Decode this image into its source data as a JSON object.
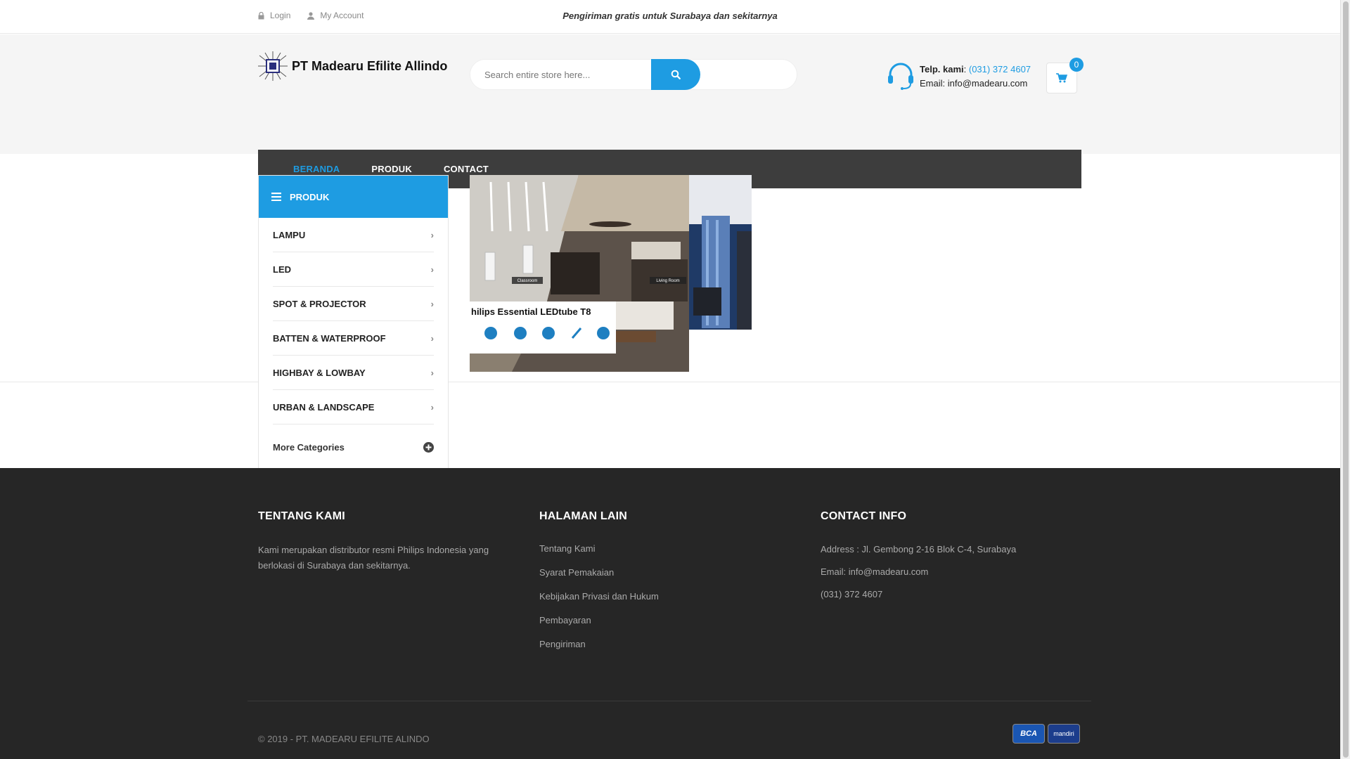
{
  "topbar": {
    "login": "Login",
    "account": "My Account",
    "promo": "Pengiriman gratis untuk Surabaya dan sekitarnya"
  },
  "header": {
    "logo_text": "PT Madearu Efilite Allindo",
    "search_placeholder": "Search entire store here...",
    "phone_label": "Telp. kami",
    "phone": "(031) 372 4607",
    "email_line": "Email: info@madearu.com",
    "cart_count": "0"
  },
  "nav": {
    "items": [
      {
        "label": "BERANDA",
        "active": true
      },
      {
        "label": "PRODUK",
        "active": false
      },
      {
        "label": "CONTACT",
        "active": false
      }
    ]
  },
  "categories": {
    "title": "PRODUK",
    "items": [
      {
        "label": "LAMPU"
      },
      {
        "label": "LED"
      },
      {
        "label": "SPOT & PROJECTOR"
      },
      {
        "label": "BATTEN & WATERPROOF"
      },
      {
        "label": "HIGHBAY & LOWBAY"
      },
      {
        "label": "URBAN & LANDSCAPE"
      }
    ],
    "more": "More Categories"
  },
  "banner": {
    "headline": "hilips Essential LEDtube T8",
    "tag_left": "Classroom",
    "tag_right": "Living Room"
  },
  "footer": {
    "about_title": "TENTANG KAMI",
    "about_text": "Kami merupakan distributor resmi Philips Indonesia yang berlokasi di Surabaya dan sekitarnya.",
    "pages_title": "HALAMAN LAIN",
    "pages": [
      {
        "label": "Tentang Kami"
      },
      {
        "label": "Syarat Pemakaian"
      },
      {
        "label": "Kebijakan Privasi dan Hukum"
      },
      {
        "label": "Pembayaran"
      },
      {
        "label": "Pengiriman"
      }
    ],
    "contact_title": "CONTACT INFO",
    "address": "Address : Jl. Gembong 2-16 Blok C-4, Surabaya",
    "email": "Email: info@madearu.com",
    "phone": "(031) 372 4607",
    "copyright": "© 2019 - PT. MADEARU EFILITE ALINDO",
    "payment_bca": "BCA",
    "payment_mandiri": "mandiri"
  },
  "colors": {
    "accent": "#1e9ce2",
    "nav_bg": "#3d3d3d",
    "footer_bg": "#262626"
  }
}
